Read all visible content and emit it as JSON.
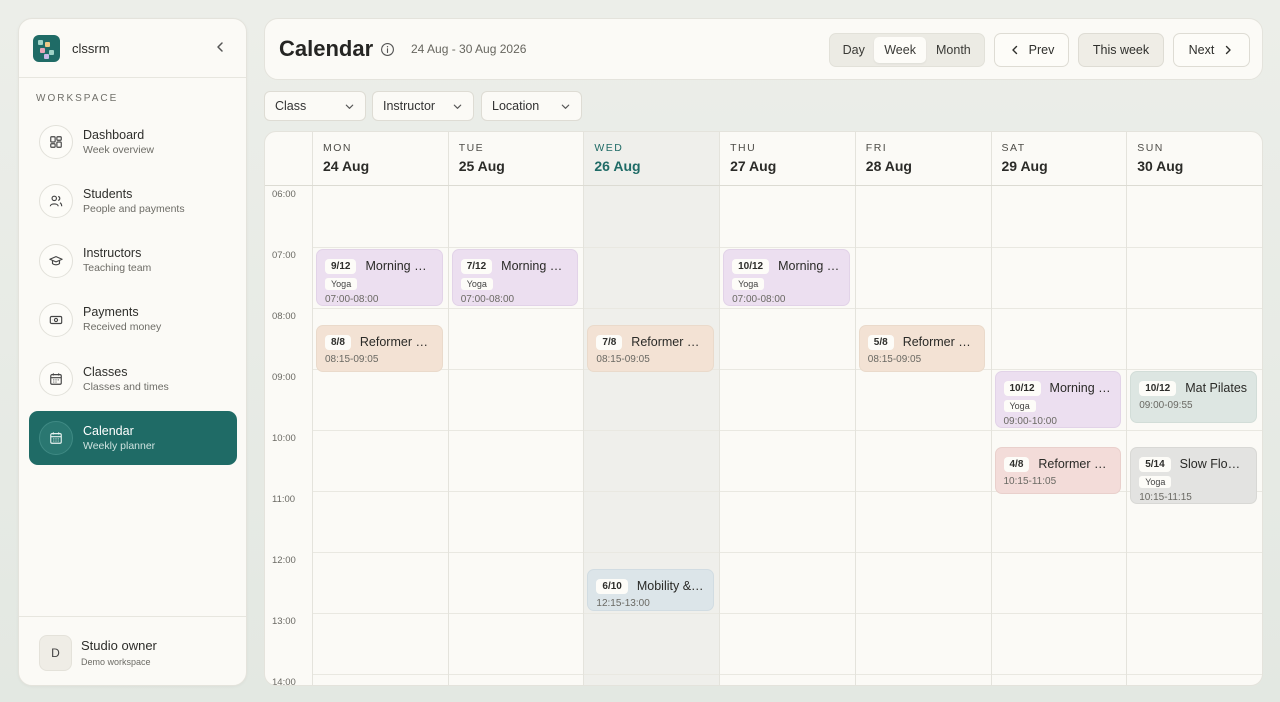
{
  "brand": {
    "name": "clssrm"
  },
  "sidebar": {
    "section_label": "WORKSPACE",
    "items": [
      {
        "title": "Dashboard",
        "subtitle": "Week overview",
        "icon": "grid-icon"
      },
      {
        "title": "Students",
        "subtitle": "People and payments",
        "icon": "users-icon"
      },
      {
        "title": "Instructors",
        "subtitle": "Teaching team",
        "icon": "graduation-cap-icon"
      },
      {
        "title": "Payments",
        "subtitle": "Received money",
        "icon": "banknote-icon"
      },
      {
        "title": "Classes",
        "subtitle": "Classes and times",
        "icon": "calendar-grid-icon"
      },
      {
        "title": "Calendar",
        "subtitle": "Weekly planner",
        "icon": "calendar-icon",
        "active": true
      }
    ],
    "owner": {
      "initial": "D",
      "name": "Studio owner",
      "subtitle": "Demo workspace"
    }
  },
  "header": {
    "title": "Calendar",
    "date_range": "24 Aug - 30 Aug 2026",
    "views": [
      "Day",
      "Week",
      "Month"
    ],
    "active_view": "Week",
    "prev_label": "Prev",
    "this_week_label": "This week",
    "next_label": "Next"
  },
  "filters": {
    "class": "Class",
    "instructor": "Instructor",
    "location": "Location"
  },
  "calendar": {
    "days": [
      {
        "dow": "MON",
        "date": "24 Aug"
      },
      {
        "dow": "TUE",
        "date": "25 Aug"
      },
      {
        "dow": "WED",
        "date": "26 Aug",
        "today": true
      },
      {
        "dow": "THU",
        "date": "27 Aug"
      },
      {
        "dow": "FRI",
        "date": "28 Aug"
      },
      {
        "dow": "SAT",
        "date": "29 Aug"
      },
      {
        "dow": "SUN",
        "date": "30 Aug"
      }
    ],
    "hours": [
      "06:00",
      "07:00",
      "08:00",
      "09:00",
      "10:00",
      "11:00",
      "12:00",
      "13:00",
      "14:00"
    ],
    "events": [
      {
        "day": 0,
        "count": "9/12",
        "title": "Morning Flow",
        "tag": "Yoga",
        "time": "07:00-08:00",
        "start": 7.0,
        "end": 8.0,
        "color": "purple"
      },
      {
        "day": 1,
        "count": "7/12",
        "title": "Morning Flow",
        "tag": "Yoga",
        "time": "07:00-08:00",
        "start": 7.0,
        "end": 8.0,
        "color": "purple"
      },
      {
        "day": 3,
        "count": "10/12",
        "title": "Morning Flow",
        "tag": "Yoga",
        "time": "07:00-08:00",
        "start": 7.0,
        "end": 8.0,
        "color": "purple"
      },
      {
        "day": 0,
        "count": "8/8",
        "title": "Reformer Pilates",
        "tag": "",
        "time": "08:15-09:05",
        "start": 8.25,
        "end": 9.0833,
        "color": "peach"
      },
      {
        "day": 2,
        "count": "7/8",
        "title": "Reformer Pilates",
        "tag": "",
        "time": "08:15-09:05",
        "start": 8.25,
        "end": 9.0833,
        "color": "peach"
      },
      {
        "day": 4,
        "count": "5/8",
        "title": "Reformer Pilates",
        "tag": "",
        "time": "08:15-09:05",
        "start": 8.25,
        "end": 9.0833,
        "color": "peach"
      },
      {
        "day": 5,
        "count": "10/12",
        "title": "Morning Flow",
        "tag": "Yoga",
        "time": "09:00-10:00",
        "start": 9.0,
        "end": 10.0,
        "color": "purple"
      },
      {
        "day": 6,
        "count": "10/12",
        "title": "Mat Pilates",
        "tag": "",
        "time": "09:00-09:55",
        "start": 9.0,
        "end": 9.9167,
        "color": "sage"
      },
      {
        "day": 5,
        "count": "4/8",
        "title": "Reformer Pilates",
        "tag": "",
        "time": "10:15-11:05",
        "start": 10.25,
        "end": 11.0833,
        "color": "pink"
      },
      {
        "day": 6,
        "count": "5/14",
        "title": "Slow Flow Yoga",
        "tag": "Yoga",
        "time": "10:15-11:15",
        "start": 10.25,
        "end": 11.25,
        "color": "grey"
      },
      {
        "day": 2,
        "count": "6/10",
        "title": "Mobility & Stretch",
        "tag": "",
        "time": "12:15-13:00",
        "start": 12.25,
        "end": 13.0,
        "color": "blue"
      }
    ]
  }
}
